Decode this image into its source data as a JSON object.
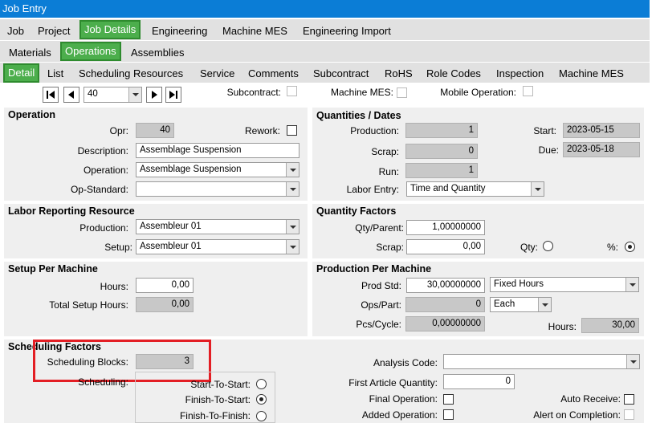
{
  "window": {
    "title": "Job Entry"
  },
  "main_tabs": [
    "Job",
    "Project",
    "Job Details",
    "Engineering",
    "Machine MES",
    "Engineering Import"
  ],
  "sub_tabs": [
    "Materials",
    "Operations",
    "Assemblies"
  ],
  "detail_tabs": [
    "Detail",
    "List",
    "Scheduling Resources",
    "Service",
    "Comments",
    "Subcontract",
    "RoHS",
    "Role Codes",
    "Inspection",
    "Machine MES"
  ],
  "nav": {
    "value": "40"
  },
  "flags": {
    "subcontract": "Subcontract:",
    "machine_mes": "Machine MES:",
    "mobile_operation": "Mobile Operation:"
  },
  "operation": {
    "title": "Operation",
    "opr_label": "Opr:",
    "opr_value": "40",
    "rework_label": "Rework:",
    "description_label": "Description:",
    "description_value": "Assemblage Suspension",
    "operation_label": "Operation:",
    "operation_value": "Assemblage Suspension",
    "op_standard_label": "Op-Standard:",
    "op_standard_value": ""
  },
  "quantities": {
    "title": "Quantities / Dates",
    "production_label": "Production:",
    "production_value": "1",
    "scrap_label": "Scrap:",
    "scrap_value": "0",
    "run_label": "Run:",
    "run_value": "1",
    "labor_entry_label": "Labor Entry:",
    "labor_entry_value": "Time and Quantity",
    "start_label": "Start:",
    "start_value": "2023-05-15",
    "due_label": "Due:",
    "due_value": "2023-05-18"
  },
  "labor": {
    "title": "Labor Reporting Resource",
    "production_label": "Production:",
    "production_value": "Assembleur 01",
    "setup_label": "Setup:",
    "setup_value": "Assembleur 01"
  },
  "qty_factors": {
    "title": "Quantity Factors",
    "qty_parent_label": "Qty/Parent:",
    "qty_parent_value": "1,00000000",
    "scrap_label": "Scrap:",
    "scrap_value": "0,00",
    "qty_label": "Qty:",
    "pct_label": "%:"
  },
  "setup_machine": {
    "title": "Setup Per Machine",
    "hours_label": "Hours:",
    "hours_value": "0,00",
    "total_label": "Total Setup Hours:",
    "total_value": "0,00"
  },
  "prod_machine": {
    "title": "Production Per Machine",
    "prod_std_label": "Prod Std:",
    "prod_std_value": "30,00000000",
    "prod_std_unit": "Fixed Hours",
    "ops_part_label": "Ops/Part:",
    "ops_part_value": "0",
    "ops_part_unit": "Each",
    "pcs_cycle_label": "Pcs/Cycle:",
    "pcs_cycle_value": "0,00000000",
    "hours_label": "Hours:",
    "hours_value": "30,00"
  },
  "scheduling": {
    "title": "Scheduling Factors",
    "blocks_label": "Scheduling Blocks:",
    "blocks_value": "3",
    "scheduling_label": "Scheduling:",
    "start_to_start": "Start-To-Start:",
    "finish_to_start": "Finish-To-Start:",
    "finish_to_finish": "Finish-To-Finish:",
    "analysis_code_label": "Analysis Code:",
    "analysis_code_value": "",
    "first_article_label": "First Article Quantity:",
    "first_article_value": "0",
    "final_operation_label": "Final Operation:",
    "added_operation_label": "Added Operation:",
    "auto_receive_label": "Auto Receive:",
    "alert_completion_label": "Alert on Completion:"
  },
  "colors": {
    "title_bar": "#0b7dd6",
    "active_tab": "#4cae4c",
    "highlight": "#e31e24"
  }
}
